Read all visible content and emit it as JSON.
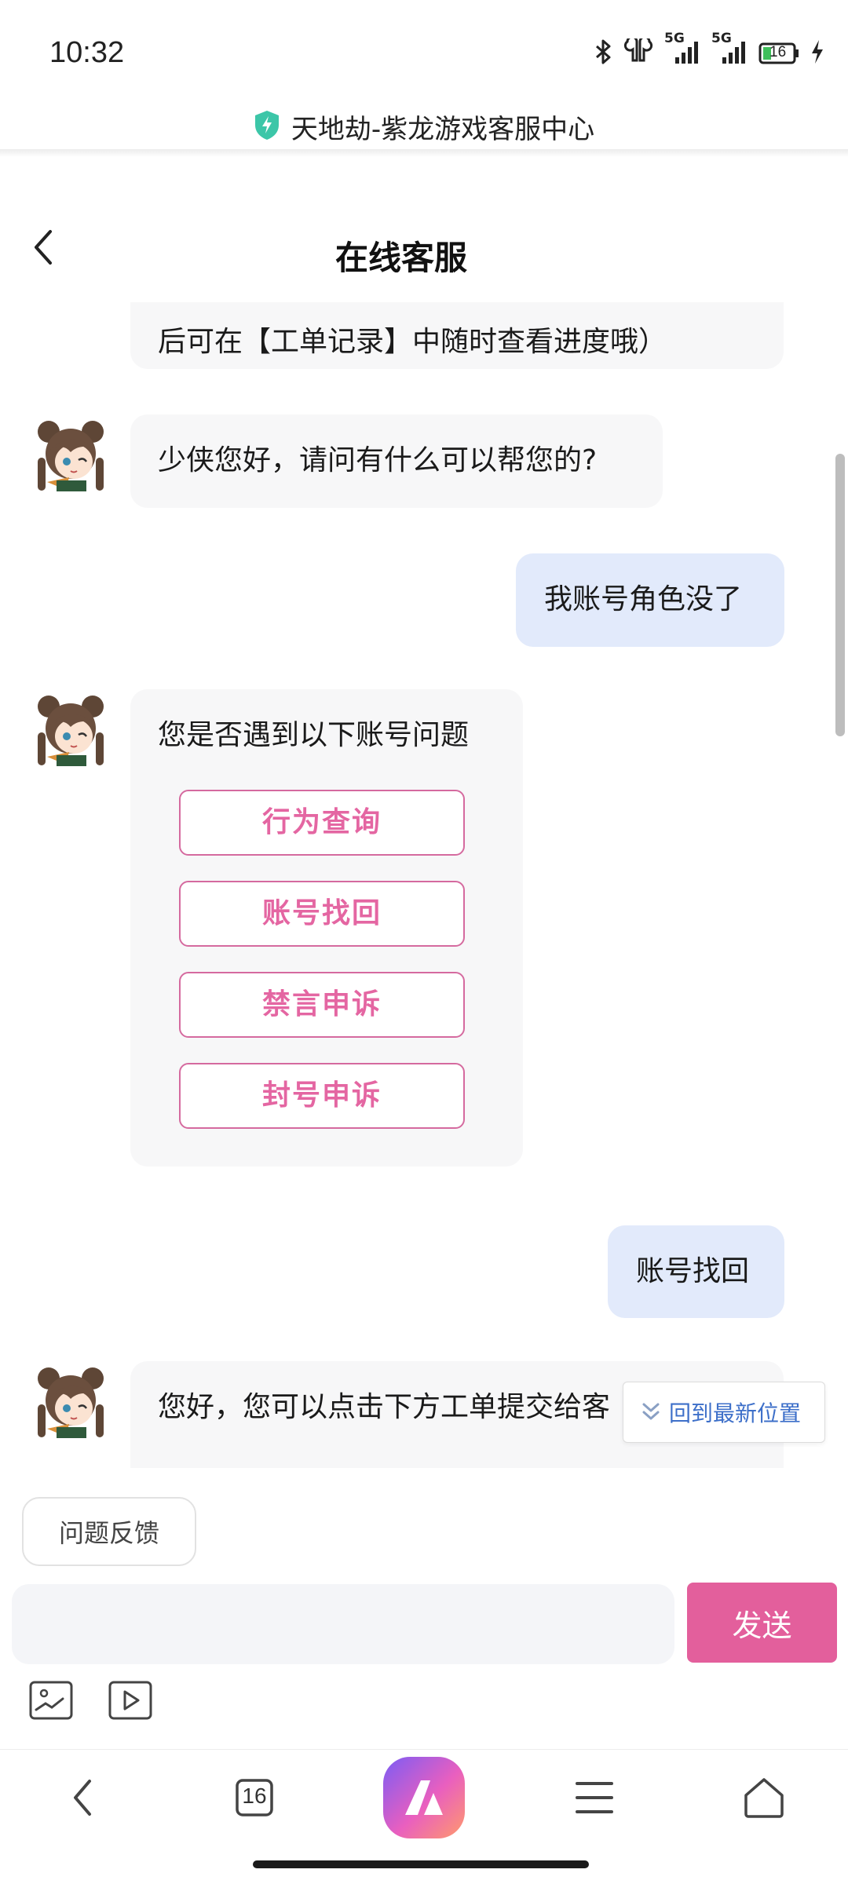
{
  "status_bar": {
    "time": "10:32",
    "network_1": "5G",
    "network_2": "5G",
    "battery": "16",
    "icons": [
      "bluetooth-icon",
      "earbuds-icon",
      "signal-icon",
      "signal-icon",
      "battery-icon",
      "charging-icon"
    ]
  },
  "site": {
    "title": "天地劫-紫龙游戏客服中心",
    "shield_color": "#3cc6a8"
  },
  "header": {
    "title": "在线客服"
  },
  "chat": {
    "messages": [
      {
        "from": "bot",
        "text": "后可在【工单记录】中随时查看进度哦）"
      },
      {
        "from": "bot",
        "text": "少侠您好，请问有什么可以帮您的?"
      },
      {
        "from": "user",
        "text": "我账号角色没了"
      },
      {
        "from": "bot",
        "text": "您是否遇到以下账号问题",
        "options": [
          "行为查询",
          "账号找回",
          "禁言申诉",
          "封号申诉"
        ]
      },
      {
        "from": "user",
        "text": "账号找回"
      },
      {
        "from": "bot",
        "text": "您好，您可以点击下方工单提交给客"
      }
    ],
    "jump_latest_label": "回到最新位置"
  },
  "composer": {
    "feedback_label": "问题反馈",
    "input_value": "",
    "send_label": "发送",
    "tools": [
      "image-icon",
      "video-icon"
    ]
  },
  "browser_nav": {
    "tab_count": "16",
    "items": [
      "back-icon",
      "tabs-icon",
      "app-logo-icon",
      "menu-icon",
      "home-icon"
    ]
  },
  "colors": {
    "accent": "#e35f9c",
    "option_text": "#e466a2",
    "user_bubble": "#e2eafb",
    "bot_bubble": "#f7f7f8",
    "link": "#3d6fc9"
  }
}
